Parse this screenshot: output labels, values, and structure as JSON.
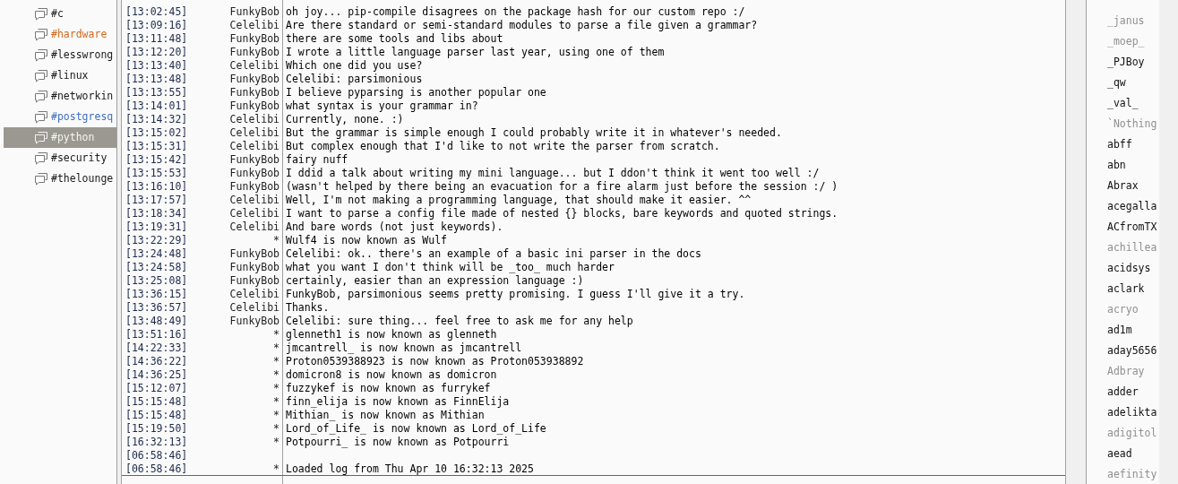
{
  "channels": [
    {
      "name": "#c",
      "color": "#1a1a1a",
      "selected": false
    },
    {
      "name": "#hardware",
      "color": "#d2691e",
      "selected": false
    },
    {
      "name": "#lesswrong",
      "color": "#1a1a1a",
      "selected": false
    },
    {
      "name": "#linux",
      "color": "#1a1a1a",
      "selected": false
    },
    {
      "name": "#networkin",
      "color": "#1a1a1a",
      "selected": false
    },
    {
      "name": "#postgresq",
      "color": "#3f6fc4",
      "selected": false
    },
    {
      "name": "#python",
      "color": "#f4f4f4",
      "selected": true
    },
    {
      "name": "#security",
      "color": "#1a1a1a",
      "selected": false
    },
    {
      "name": "#thelounge",
      "color": "#1a1a1a",
      "selected": false
    }
  ],
  "log": [
    {
      "time": "[13:02:45]",
      "nick": "FunkyBob",
      "text": "oh joy... pip-compile disagrees on the package hash for our custom repo :/",
      "marker_below": false
    },
    {
      "time": "[13:09:16]",
      "nick": "Celelibi",
      "text": "Are there standard or semi-standard modules to parse a file given a grammar?",
      "marker_below": false
    },
    {
      "time": "[13:11:48]",
      "nick": "FunkyBob",
      "text": "there are some tools and libs about",
      "marker_below": false
    },
    {
      "time": "[13:12:20]",
      "nick": "FunkyBob",
      "text": "I wrote a little language parser last year, using one of them",
      "marker_below": false
    },
    {
      "time": "[13:13:40]",
      "nick": "Celelibi",
      "text": "Which one did you use?",
      "marker_below": false
    },
    {
      "time": "[13:13:48]",
      "nick": "FunkyBob",
      "text": "Celelibi: parsimonious",
      "marker_below": false
    },
    {
      "time": "[13:13:55]",
      "nick": "FunkyBob",
      "text": "I believe pyparsing is another popular one",
      "marker_below": false
    },
    {
      "time": "[13:14:01]",
      "nick": "FunkyBob",
      "text": "what syntax is your grammar in?",
      "marker_below": false
    },
    {
      "time": "[13:14:32]",
      "nick": "Celelibi",
      "text": "Currently, none. :)",
      "marker_below": false
    },
    {
      "time": "[13:15:02]",
      "nick": "Celelibi",
      "text": "But the grammar is simple enough I could probably write it in whatever's needed.",
      "marker_below": false
    },
    {
      "time": "[13:15:31]",
      "nick": "Celelibi",
      "text": "But complex enough that I'd like to not write the parser from scratch.",
      "marker_below": false
    },
    {
      "time": "[13:15:42]",
      "nick": "FunkyBob",
      "text": "fairy nuff",
      "marker_below": false
    },
    {
      "time": "[13:15:53]",
      "nick": "FunkyBob",
      "text": "I ddid a talk about writing my mini language... but I ddon't think it went too well :/",
      "marker_below": false
    },
    {
      "time": "[13:16:10]",
      "nick": "FunkyBob",
      "text": "(wasn't helped by there being an evacuation for a fire alarm just before the session :/ )",
      "marker_below": false
    },
    {
      "time": "[13:17:57]",
      "nick": "Celelibi",
      "text": "Well, I'm not making a programming language, that should make it easier. ^^",
      "marker_below": false
    },
    {
      "time": "[13:18:34]",
      "nick": "Celelibi",
      "text": "I want to parse a config file made of nested {} blocks, bare keywords and quoted strings.",
      "marker_below": false
    },
    {
      "time": "[13:19:31]",
      "nick": "Celelibi",
      "text": "And bare words (not just keywords).",
      "marker_below": false
    },
    {
      "time": "[13:22:29]",
      "nick": "*",
      "text": "Wulf4 is now known as Wulf",
      "marker_below": false
    },
    {
      "time": "[13:24:48]",
      "nick": "FunkyBob",
      "text": "Celelibi: ok.. there's an example of a basic ini parser in the docs",
      "marker_below": false
    },
    {
      "time": "[13:24:58]",
      "nick": "FunkyBob",
      "text": "what you want I don't think will be _too_ much harder",
      "marker_below": false
    },
    {
      "time": "[13:25:08]",
      "nick": "FunkyBob",
      "text": "certainly, easier than an expression language :)",
      "marker_below": false
    },
    {
      "time": "[13:36:15]",
      "nick": "Celelibi",
      "text": "FunkyBob, parsimonious seems pretty promising. I guess I'll give it a try.",
      "marker_below": false
    },
    {
      "time": "[13:36:57]",
      "nick": "Celelibi",
      "text": "Thanks.",
      "marker_below": false
    },
    {
      "time": "[13:48:49]",
      "nick": "FunkyBob",
      "text": "Celelibi: sure thing... feel free to ask me for any help",
      "marker_below": false
    },
    {
      "time": "[13:51:16]",
      "nick": "*",
      "text": "glenneth1 is now known as glenneth",
      "marker_below": false
    },
    {
      "time": "[14:22:33]",
      "nick": "*",
      "text": "jmcantrell_ is now known as jmcantrell",
      "marker_below": false
    },
    {
      "time": "[14:36:22]",
      "nick": "*",
      "text": "Proton0539388923 is now known as Proton053938892",
      "marker_below": false
    },
    {
      "time": "[14:36:25]",
      "nick": "*",
      "text": "domicron8 is now known as domicron",
      "marker_below": false
    },
    {
      "time": "[15:12:07]",
      "nick": "*",
      "text": "fuzzykef is now known as furrykef",
      "marker_below": false
    },
    {
      "time": "[15:15:48]",
      "nick": "*",
      "text": "finn_elija is now known as FinnElija",
      "marker_below": false
    },
    {
      "time": "[15:15:48]",
      "nick": "*",
      "text": "Mithian_ is now known as Mithian",
      "marker_below": false
    },
    {
      "time": "[15:19:50]",
      "nick": "*",
      "text": "Lord_of_Life_ is now known as Lord_of_Life",
      "marker_below": false
    },
    {
      "time": "[16:32:13]",
      "nick": "*",
      "text": "Potpourri_ is now known as Potpourri",
      "marker_below": false
    },
    {
      "time": "[06:58:46]",
      "marker_below": false
    },
    {
      "time": "[06:58:46]",
      "nick": "*",
      "text": "Loaded log from Thu Apr 10 16:32:13 2025",
      "marker_below": true
    }
  ],
  "users": [
    {
      "name": "_janus",
      "away": true
    },
    {
      "name": "_moep_",
      "away": true
    },
    {
      "name": "_PJBoy",
      "away": false
    },
    {
      "name": "_qw",
      "away": false
    },
    {
      "name": "_val_",
      "away": false
    },
    {
      "name": "`Nothing",
      "away": true
    },
    {
      "name": "abff",
      "away": false
    },
    {
      "name": "abn",
      "away": false
    },
    {
      "name": "Abrax",
      "away": false
    },
    {
      "name": "acegalla",
      "away": false
    },
    {
      "name": "ACfromTX",
      "away": false
    },
    {
      "name": "achillea",
      "away": true
    },
    {
      "name": "acidsys",
      "away": false
    },
    {
      "name": "aclark",
      "away": false
    },
    {
      "name": "acryo",
      "away": true
    },
    {
      "name": "ad1m",
      "away": false
    },
    {
      "name": "aday5656",
      "away": false
    },
    {
      "name": "Adbray",
      "away": true
    },
    {
      "name": "adder",
      "away": false
    },
    {
      "name": "adelikta",
      "away": false
    },
    {
      "name": "adigitol",
      "away": true
    },
    {
      "name": "aead",
      "away": false
    },
    {
      "name": "aefinity",
      "away": true
    }
  ]
}
